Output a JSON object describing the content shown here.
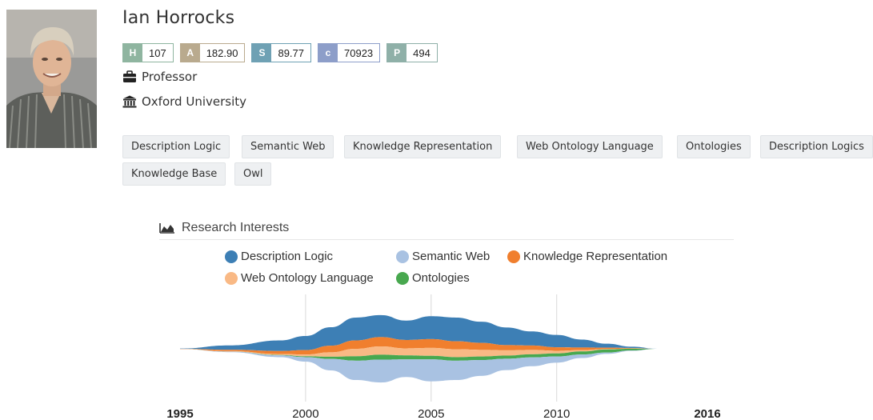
{
  "profile": {
    "name": "Ian Horrocks",
    "position": "Professor",
    "affiliation": "Oxford University",
    "metrics": [
      {
        "key": "H",
        "value": "107",
        "color": "#8fb5a0"
      },
      {
        "key": "A",
        "value": "182.90",
        "color": "#b9aa8e"
      },
      {
        "key": "S",
        "value": "89.77",
        "color": "#6fa1b4"
      },
      {
        "key": "c",
        "value": "70923",
        "color": "#8d9ec9"
      },
      {
        "key": "P",
        "value": "494",
        "color": "#8fb0a8"
      }
    ],
    "tags": [
      "Description Logic",
      "Semantic Web",
      "Knowledge Representation",
      "Web Ontology Language",
      "Ontologies",
      "Description Logics",
      "Knowledge Base",
      "Owl"
    ]
  },
  "research": {
    "title": "Research Interests",
    "legend": [
      {
        "name": "Description Logic",
        "color": "#3d7fb5"
      },
      {
        "name": "Semantic Web",
        "color": "#a9c2e2"
      },
      {
        "name": "Knowledge Representation",
        "color": "#f07f2e"
      },
      {
        "name": "Web Ontology Language",
        "color": "#f9b985"
      },
      {
        "name": "Ontologies",
        "color": "#48a84f"
      }
    ]
  },
  "chart_data": {
    "type": "area",
    "x_ticks": [
      {
        "label": "1995",
        "value": 1995,
        "bold": true
      },
      {
        "label": "2000",
        "value": 2000,
        "bold": false
      },
      {
        "label": "2005",
        "value": 2005,
        "bold": false
      },
      {
        "label": "2010",
        "value": 2010,
        "bold": false
      },
      {
        "label": "2016",
        "value": 2016,
        "bold": true
      }
    ],
    "x": [
      1995,
      1997,
      1999,
      2000,
      2001,
      2002,
      2003,
      2004,
      2005,
      2006,
      2007,
      2008,
      2009,
      2010,
      2011,
      2012,
      2013,
      2014
    ],
    "series": [
      {
        "name": "Description Logic",
        "values": [
          0.05,
          0.5,
          1.2,
          1.6,
          2.1,
          2.6,
          2.5,
          2.2,
          2.6,
          2.7,
          2.4,
          2.0,
          1.6,
          1.4,
          0.9,
          0.45,
          0.15,
          0.0
        ]
      },
      {
        "name": "Knowledge Representation",
        "values": [
          0.02,
          0.15,
          0.35,
          0.5,
          0.75,
          0.95,
          1.05,
          0.95,
          1.0,
          0.9,
          0.8,
          0.6,
          0.5,
          0.4,
          0.3,
          0.15,
          0.05,
          0.0
        ]
      },
      {
        "name": "Web Ontology Language",
        "values": [
          0.0,
          0.05,
          0.1,
          0.2,
          0.5,
          0.85,
          0.95,
          0.8,
          0.9,
          0.9,
          0.75,
          0.6,
          0.5,
          0.3,
          0.15,
          0.05,
          0.02,
          0.0
        ]
      },
      {
        "name": "Ontologies",
        "values": [
          0.0,
          0.02,
          0.05,
          0.1,
          0.25,
          0.5,
          0.55,
          0.45,
          0.4,
          0.4,
          0.4,
          0.35,
          0.35,
          0.35,
          0.35,
          0.35,
          0.2,
          0.0
        ]
      },
      {
        "name": "Semantic Web",
        "values": [
          0.0,
          0.05,
          0.2,
          0.5,
          1.3,
          2.2,
          2.6,
          2.0,
          2.5,
          2.2,
          1.8,
          1.3,
          1.0,
          0.7,
          0.4,
          0.15,
          0.05,
          0.0
        ]
      }
    ]
  }
}
